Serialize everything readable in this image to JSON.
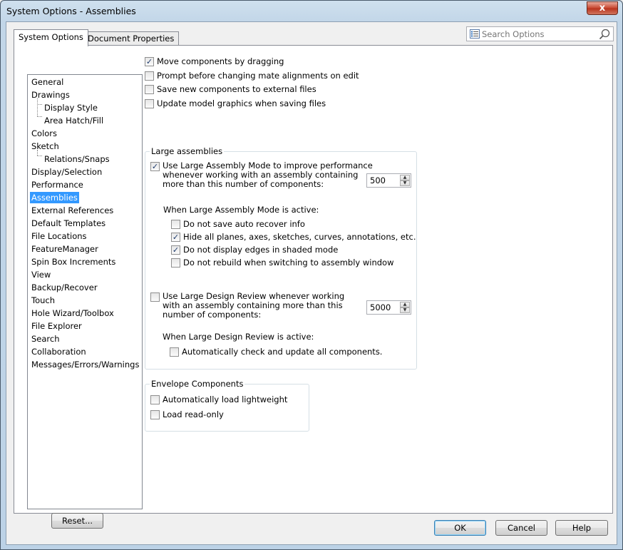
{
  "window": {
    "title": "System Options - Assemblies",
    "close_glyph": "x"
  },
  "tabs": [
    {
      "label": "System Options",
      "active": true
    },
    {
      "label": "Document Properties",
      "active": false
    }
  ],
  "search": {
    "placeholder": "Search Options"
  },
  "tree": {
    "items": [
      {
        "label": "General",
        "level": 0
      },
      {
        "label": "Drawings",
        "level": 0
      },
      {
        "label": "Display Style",
        "level": 1
      },
      {
        "label": "Area Hatch/Fill",
        "level": 1
      },
      {
        "label": "Colors",
        "level": 0
      },
      {
        "label": "Sketch",
        "level": 0
      },
      {
        "label": "Relations/Snaps",
        "level": 1
      },
      {
        "label": "Display/Selection",
        "level": 0
      },
      {
        "label": "Performance",
        "level": 0
      },
      {
        "label": "Assemblies",
        "level": 0,
        "selected": true
      },
      {
        "label": "External References",
        "level": 0
      },
      {
        "label": "Default Templates",
        "level": 0
      },
      {
        "label": "File Locations",
        "level": 0
      },
      {
        "label": "FeatureManager",
        "level": 0
      },
      {
        "label": "Spin Box Increments",
        "level": 0
      },
      {
        "label": "View",
        "level": 0
      },
      {
        "label": "Backup/Recover",
        "level": 0
      },
      {
        "label": "Touch",
        "level": 0
      },
      {
        "label": "Hole Wizard/Toolbox",
        "level": 0
      },
      {
        "label": "File Explorer",
        "level": 0
      },
      {
        "label": "Search",
        "level": 0
      },
      {
        "label": "Collaboration",
        "level": 0
      },
      {
        "label": "Messages/Errors/Warnings",
        "level": 0
      }
    ]
  },
  "reset_label": "Reset...",
  "options": {
    "top": [
      {
        "label": "Move components by dragging",
        "checked": true
      },
      {
        "label": "Prompt before changing mate alignments on edit",
        "checked": false
      },
      {
        "label": "Save new components to external files",
        "checked": false
      },
      {
        "label": "Update model graphics when saving files",
        "checked": false
      }
    ],
    "large_assemblies": {
      "title": "Large assemblies",
      "lam_checked": true,
      "lam_line1": "Use Large Assembly Mode to improve performance",
      "lam_line2": "whenever working with an assembly containing",
      "lam_line3": "more than this number of components:",
      "lam_value": "500",
      "lam_active_label": "When Large Assembly Mode is active:",
      "lam_sub": [
        {
          "label": "Do not save auto recover info",
          "checked": false
        },
        {
          "label": "Hide all planes, axes, sketches, curves, annotations, etc.",
          "checked": true
        },
        {
          "label": "Do not display edges in shaded mode",
          "checked": true
        },
        {
          "label": "Do not rebuild when switching to assembly window",
          "checked": false
        }
      ],
      "ldr_checked": false,
      "ldr_line1": "Use Large Design Review whenever working",
      "ldr_line2": "with an assembly containing more than this",
      "ldr_line3": "number of components:",
      "ldr_value": "5000",
      "ldr_active_label": "When Large Design Review is active:",
      "ldr_sub": {
        "label": "Automatically check and update all components.",
        "checked": false
      }
    },
    "envelope": {
      "title": "Envelope Components",
      "items": [
        {
          "label": "Automatically load lightweight",
          "checked": false
        },
        {
          "label": "Load read-only",
          "checked": false
        }
      ]
    }
  },
  "buttons": {
    "ok": "OK",
    "cancel": "Cancel",
    "help": "Help"
  },
  "check_glyph": "✓",
  "spin_up_glyph": "▲",
  "spin_down_glyph": "▼"
}
